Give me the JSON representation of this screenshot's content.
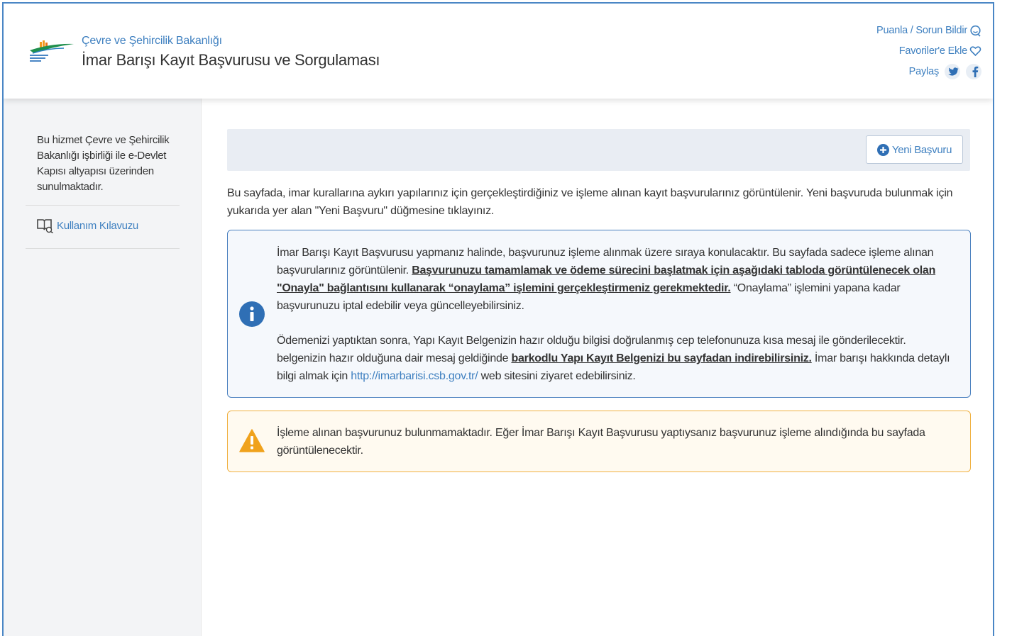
{
  "header": {
    "ministry": "Çevre ve Şehircilik Bakanlığı",
    "service_title": "İmar Barışı Kayıt Başvurusu ve Sorgulaması",
    "rate_label": "Puanla / Sorun Bildir",
    "favorites_label": "Favoriler'e Ekle",
    "share_label": "Paylaş",
    "icons": {
      "rate": "chat-bubble-icon",
      "favorites": "heart-icon",
      "twitter": "twitter-icon",
      "facebook": "facebook-icon"
    }
  },
  "sidebar": {
    "info": "Bu hizmet Çevre ve Şehircilik Bakanlığı işbirliği ile e-Devlet Kapısı altyapısı üzerinden sunulmaktadır.",
    "guide_label": "Kullanım Kılavuzu",
    "guide_icon": "book-icon"
  },
  "toolbar": {
    "new_button": "Yeni Başvuru",
    "new_icon": "plus-circle-icon"
  },
  "main": {
    "description": "Bu sayfada, imar kurallarına aykırı yapılarınız için gerçekleştirdiğiniz ve işleme alınan kayıt başvurularınız görüntülenir. Yeni başvuruda bulunmak için yukarıda yer alan \"Yeni Başvuru\" düğmesine tıklayınız.",
    "info": {
      "p1_start": "İmar Barışı Kayıt Başvurusu yapmanız halinde, başvurunuz işleme alınmak üzere sıraya konulacaktır. Bu sayfada sadece işleme alınan başvurularınız görüntülenir. ",
      "p1_bold": "Başvurunuzu tamamlamak ve ödeme sürecini başlatmak için aşağıdaki tabloda görüntülenecek olan \"Onayla\" bağlantısını kullanarak “onaylama” işlemini gerçekleştirmeniz gerekmektedir.",
      "p1_end": " “Onaylama” işlemini yapana kadar başvurunuzu iptal edebilir veya güncelleyebilirsiniz.",
      "p2_start": "Ödemenizi yaptıktan sonra, Yapı Kayıt Belgenizin hazır olduğu bilgisi doğrulanmış cep telefonunuza kısa mesaj ile gönderilecektir. belgenizin hazır olduğuna dair mesaj geldiğinde ",
      "p2_bold": "barkodlu Yapı Kayıt Belgenizi bu sayfadan indirebilirsiniz.",
      "p2_mid": " İmar barışı hakkında detaylı bilgi almak için ",
      "p2_link": "http://imarbarisi.csb.gov.tr/",
      "p2_end": " web sitesini ziyaret edebilirsiniz.",
      "icon": "info-circle-icon",
      "color": "#2f6fb5"
    },
    "warning": {
      "text": "İşleme alınan başvurunuz bulunmamaktadır. Eğer İmar Barışı Kayıt Başvurusu yaptıysanız başvurunuz işleme alındığında bu sayfada görüntülenecektir.",
      "icon": "warning-triangle-icon",
      "color": "#f0a21c"
    }
  }
}
